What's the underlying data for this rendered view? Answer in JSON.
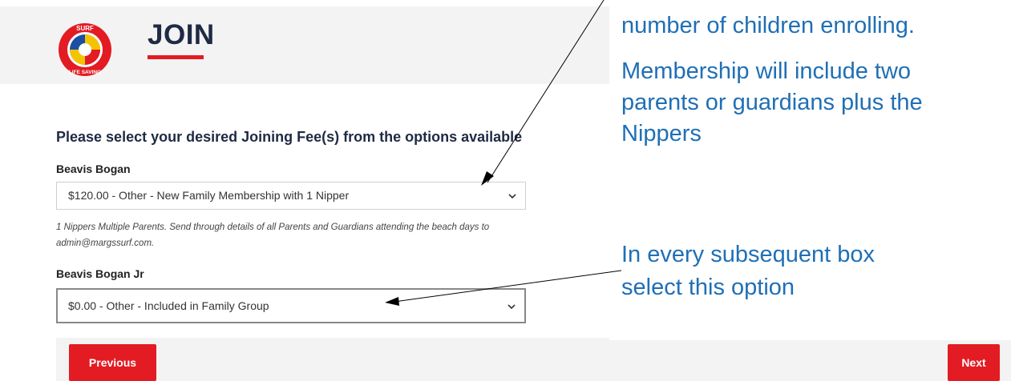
{
  "header": {
    "title": "JOIN"
  },
  "logo": {
    "top_text": "SURF",
    "bottom_text": "LIFE SAVING"
  },
  "prompt": "Please select your desired Joining Fee(s) from the options available",
  "members": [
    {
      "name": "Beavis Bogan",
      "selected": "$120.00 - Other - New Family Membership with 1 Nipper"
    },
    {
      "name": "Beavis Bogan Jr",
      "selected": "$0.00 - Other - Included in Family Group"
    }
  ],
  "help_text": "1 Nippers Multiple Parents. Send through details of all Parents and Guardians attending the beach days to admin@margssurf.com.",
  "buttons": {
    "previous": "Previous",
    "next": "Next"
  },
  "callouts": {
    "top_line1": "number of children enrolling.",
    "top_line2": "Membership will include two",
    "top_line3": "parents or guardians plus the",
    "top_line4": "Nippers",
    "bottom_line1": "In every subsequent box",
    "bottom_line2": "select this option"
  },
  "colors": {
    "accent": "#e31b23",
    "callout": "#1f6fb5",
    "title": "#1f2a44"
  }
}
